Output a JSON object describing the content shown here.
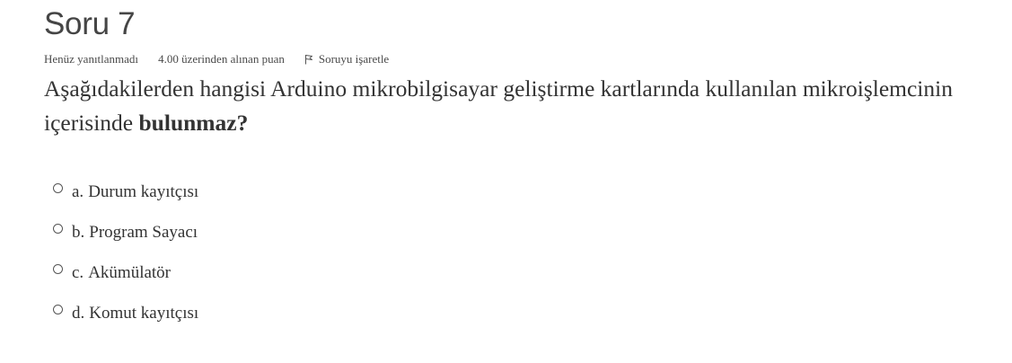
{
  "question": {
    "title": "Soru 7",
    "state": "Henüz yanıtlanmadı",
    "grade": "4.00 üzerinden alınan puan",
    "flag_label": "Soruyu işaretle",
    "text_part1": "Aşağıdakilerden hangisi Arduino mikrobilgisayar geliştirme kartlarında kullanılan mikroişlemcinin içerisinde ",
    "text_bold": "bulunmaz?",
    "answers": [
      {
        "letter": "a.",
        "label": "Durum kayıtçısı",
        "selected": false
      },
      {
        "letter": "b.",
        "label": "Program Sayacı",
        "selected": false
      },
      {
        "letter": "c.",
        "label": "Akümülatör",
        "selected": false
      },
      {
        "letter": "d.",
        "label": "Komut kayıtçısı",
        "selected": false
      }
    ]
  },
  "icons": {
    "flag": "flag-icon"
  }
}
